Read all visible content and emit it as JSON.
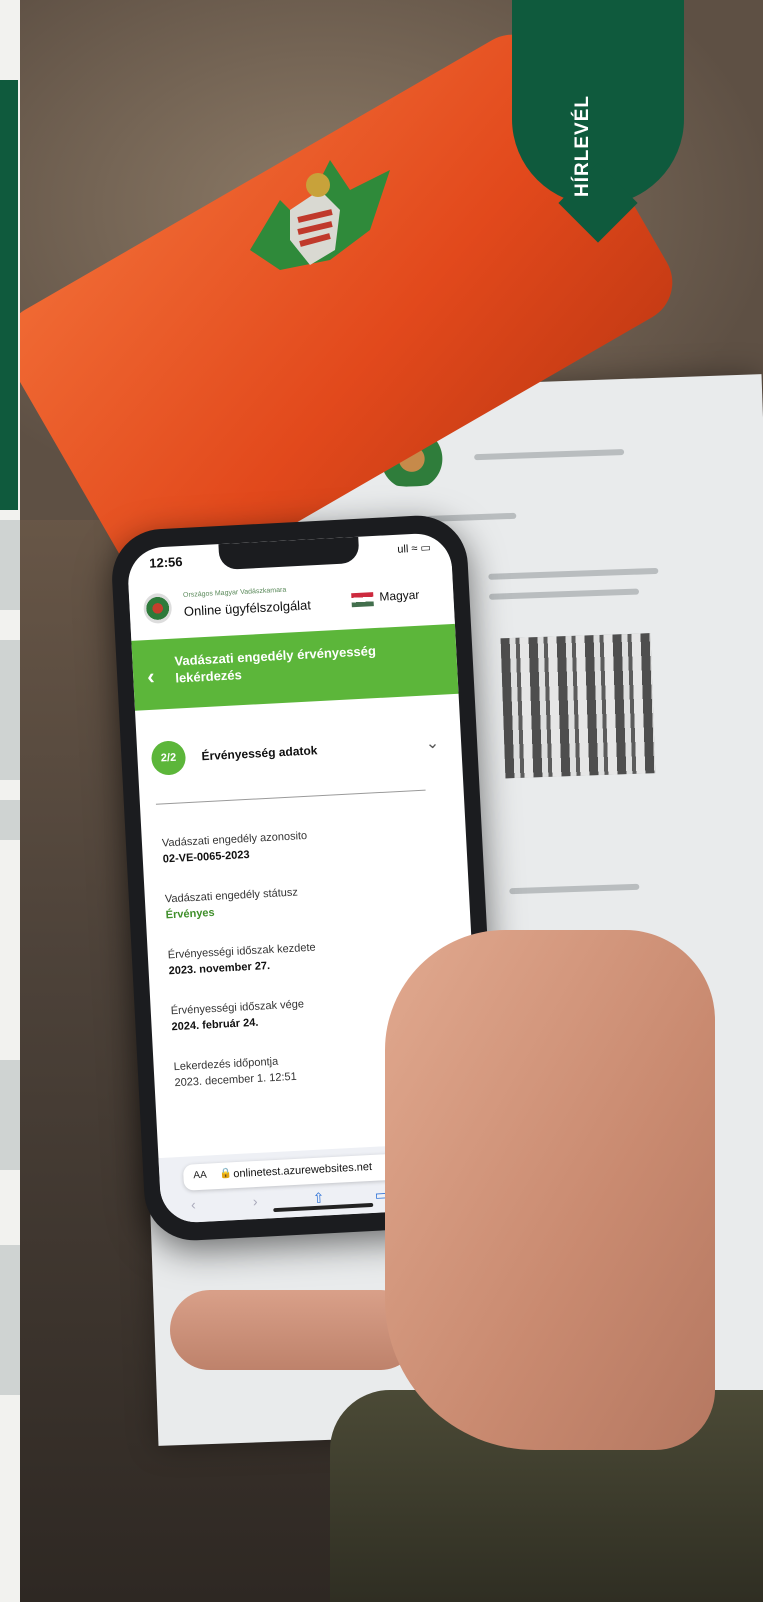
{
  "ribbon": {
    "label": "HÍRLEVÉL"
  },
  "phone": {
    "status": {
      "time": "12:56",
      "icons": "ull ≈ ▭"
    },
    "header": {
      "org_name": "Országos Magyar Vadászkamara",
      "service_name": "Online ügyfélszolgálat",
      "language": "Magyar",
      "flag_colors": [
        "#cd2a3e",
        "#ffffff",
        "#436f4d"
      ]
    },
    "title_bar": {
      "title": "Vadászati engedély érvényesség lekérdezés",
      "back_icon": "chevron-left-icon",
      "color": "#5cb63a"
    },
    "step": {
      "badge": "2/2",
      "title": "Érvényesség adatok",
      "expand_icon": "chevron-down-icon"
    },
    "fields": [
      {
        "label": "Vadászati engedély azonosito",
        "value": "02-VE-0065-2023"
      },
      {
        "label": "Vadászati engedély státusz",
        "value": "Érvényes"
      },
      {
        "label": "Érvényességi időszak kezdete",
        "value": "2023. november 27."
      },
      {
        "label": "Érvényességi időszak vége",
        "value": "2024. február 24."
      },
      {
        "label": "Lekerdezés időpontja",
        "value": "2023. december 1. 12:51"
      }
    ],
    "browser": {
      "aa": "AA",
      "url": "onlinetest.azurewebsites.net",
      "nav": {
        "back": "‹",
        "forward": "›",
        "share": "⇧",
        "bookmarks": "▭"
      }
    }
  }
}
